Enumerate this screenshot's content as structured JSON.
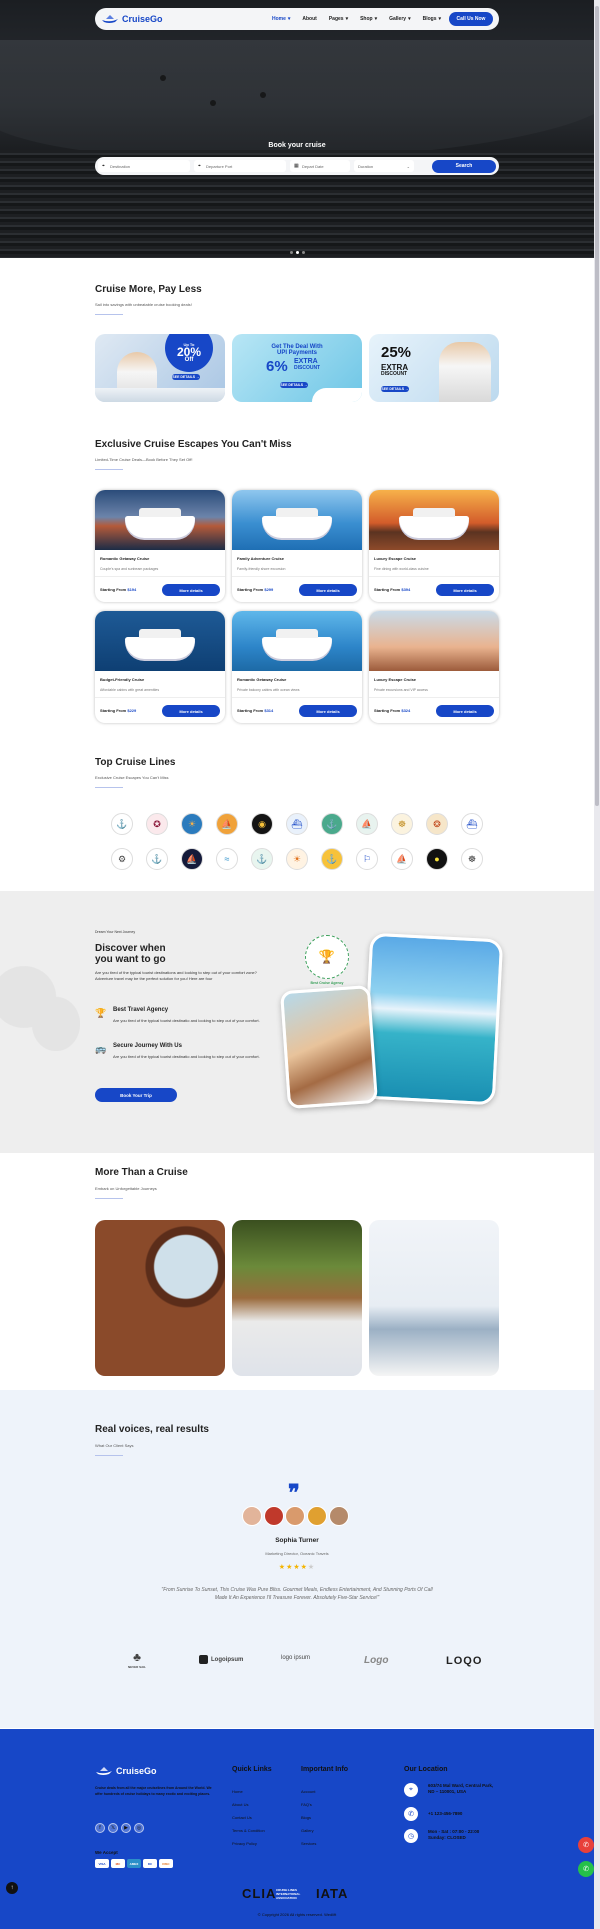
{
  "brand": {
    "name": "CruiseGo"
  },
  "nav": {
    "items": [
      "Home",
      "About",
      "Pages",
      "Shop",
      "Gallery",
      "Blogs"
    ],
    "cta": "Call Us Now"
  },
  "hero": {
    "book_title": "Book your cruise",
    "search": {
      "destination": "Destination",
      "departure_port": "Departure Port",
      "depart_date": "Depart Date",
      "duration": "Duration",
      "button": "Search"
    }
  },
  "deals": {
    "title": "Cruise More, Pay Less",
    "subtitle": "Sail into savings with unbeatable cruise booking deals!",
    "offers": [
      {
        "top": "Up To",
        "big": "20%",
        "tail": "Off",
        "button": "SEE DETAILS →"
      },
      {
        "line1": "Get The Deal With",
        "line2": "UPI Payments",
        "big": "6%",
        "extra": "EXTRA",
        "discount": "DISCOUNT",
        "button": "SEE DETAILS →"
      },
      {
        "big": "25%",
        "extra": "EXTRA",
        "discount": "DISCOUNT",
        "button": "SEE DETAILS →"
      }
    ]
  },
  "escapes": {
    "title": "Exclusive Cruise Escapes You Can't Miss",
    "subtitle": "Limited-Time Cruise Deals—Book Before They Set Off!",
    "from_label": "Starting From",
    "button": "More details",
    "cards": [
      {
        "title": "Romantic Getaway Cruise",
        "desc": "Couple's spa and sunbeam packages",
        "price": "$194"
      },
      {
        "title": "Family Adventure Cruise",
        "desc": "Family-friendly shore excursion",
        "price": "$299"
      },
      {
        "title": "Luxury Escape Cruise",
        "desc": "Fine dining with world-class cuisine",
        "price": "$394"
      },
      {
        "title": "Budget-Friendly Cruise",
        "desc": "Affordable cabins with great amenities",
        "price": "$229"
      },
      {
        "title": "Romantic Getaway Cruise",
        "desc": "Private balcony cabins with ocean views",
        "price": "$314"
      },
      {
        "title": "Luxury Escape Cruise",
        "desc": "Private excursions and VIP access",
        "price": "$324"
      }
    ]
  },
  "lines": {
    "title": "Top Cruise Lines",
    "subtitle": "Exclusive Cruise Escapes You Can't Miss"
  },
  "discover": {
    "kicker": "Dream Your Next Journey",
    "title_l1": "Discover when",
    "title_l2": "you want to go",
    "intro": "Are you tired of the typical tourist destinations and looking to step out of your comfort zone? Adventure travel may be the perfect solution for you! Here are four",
    "features": [
      {
        "title": "Best Travel Agency",
        "text": "Are you tired of the typical tourist destinatio and looking to step out of your comfort."
      },
      {
        "title": "Secure Journey With Us",
        "text": "Are you tired of the typical tourist destinatio and looking to step out of your comfort."
      }
    ],
    "button": "Book Your Trip",
    "badge": "Best Cruise Agency"
  },
  "more": {
    "title": "More Than a Cruise",
    "subtitle": "Embark on Unforgettable Journeys"
  },
  "testimonials": {
    "title": "Real voices, real results",
    "subtitle": "What Our Client Says",
    "name": "Sophia Turner",
    "role": "Marketing Director, Oceanic Travels",
    "rating": 4,
    "quote": "\"From Sunrise To Sunset, This Cruise Was Pure Bliss. Gourmet Meals, Endless Entertainment, And Stunning Ports Of Call Made It An Experience I'll Treasure Forever. Absolutely Five-Star Service!\""
  },
  "partners": [
    "NEVER SAIL",
    "Logoipsum",
    "logo ipsum",
    "Logo",
    "LOQO"
  ],
  "footer": {
    "about": "Cruise deals from all the major cruiselines from Around the World. We offer hundreds of cruise holidays to many exotic and exciting places.",
    "we_accept": "We Accept",
    "payments": [
      "VISA",
      "MC",
      "AMEX",
      "DC",
      "DISC"
    ],
    "quick_title": "Quick Links",
    "quick_links": [
      "Home",
      "About Us",
      "Contact Us",
      "Terms & Condition",
      "Privacy Policy"
    ],
    "info_title": "Important Info",
    "info_links": [
      "Account",
      "FAQ's",
      "Blogs",
      "Gallery",
      "Services"
    ],
    "loc_title": "Our Location",
    "address": "603/74 Mal Ward, Central Park, ND – 110001, USA",
    "phone": "+1 123-456-7890",
    "hours_l1": "Mon - Sat : 07:00 - 22:00",
    "hours_l2": "Sunday: CLOSED",
    "brand1": "CLIA",
    "brand1_sub": "CRUISE LINES INTERNATIONAL ASSOCIATION",
    "brand2": "IATA",
    "copyright": "© Copyright 2026 All rights reserved. Wedlift"
  }
}
